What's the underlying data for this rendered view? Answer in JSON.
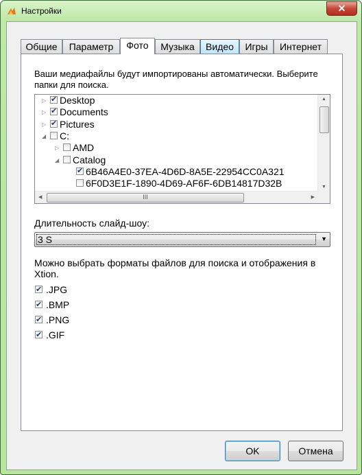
{
  "window": {
    "title": "Настройки",
    "close_glyph": "✕",
    "icon": "app-logo-icon"
  },
  "tabs": [
    {
      "label": "Общие"
    },
    {
      "label": "Параметр"
    },
    {
      "label": "Фото",
      "active": true
    },
    {
      "label": "Музыка"
    },
    {
      "label": "Видео",
      "hover": true
    },
    {
      "label": "Игры"
    },
    {
      "label": "Интернет"
    }
  ],
  "photo": {
    "intro": "Ваши медиафайлы будут импортированы автоматически. Выберите папки для поиска.",
    "tree": [
      {
        "label": "Desktop",
        "checked": true,
        "expander": "▷"
      },
      {
        "label": "Documents",
        "checked": true,
        "expander": "▷"
      },
      {
        "label": "Pictures",
        "checked": true,
        "expander": "▷"
      },
      {
        "label": "C:",
        "checked": false,
        "expander": "◢"
      },
      {
        "label": "AMD",
        "checked": false,
        "expander": "▷"
      },
      {
        "label": "Catalog",
        "checked": false,
        "expander": "◢"
      },
      {
        "label": "6B46A4E0-37EA-4D6D-8A5E-22954CC0A321",
        "checked": true,
        "expander": ""
      },
      {
        "label": "6F0D3E1F-1890-4D69-AF6F-6DB14817D32B",
        "checked": false,
        "expander": ""
      }
    ],
    "scroll_grip": "III",
    "slideshow_label": "Длительность слайд-шоу:",
    "slideshow_value": "3 S",
    "formats_label": "Можно выбрать форматы файлов для поиска и отображения в Xtion.",
    "formats": [
      {
        "label": ".JPG",
        "checked": true
      },
      {
        "label": ".BMP",
        "checked": true
      },
      {
        "label": ".PNG",
        "checked": true
      },
      {
        "label": ".GIF",
        "checked": true
      }
    ]
  },
  "buttons": {
    "ok": "OK",
    "cancel": "Отмена"
  }
}
